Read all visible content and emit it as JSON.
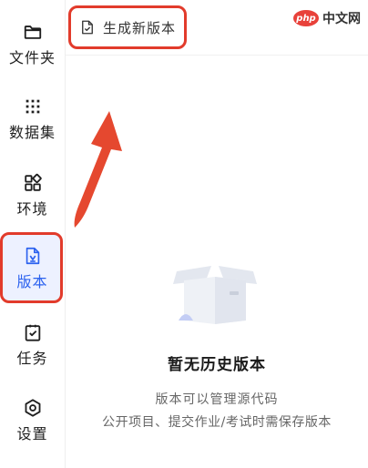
{
  "sidebar": {
    "items": [
      {
        "label": "文件夹",
        "icon": "folder-icon"
      },
      {
        "label": "数据集",
        "icon": "dataset-dots-icon"
      },
      {
        "label": "环境",
        "icon": "environment-grid-icon"
      },
      {
        "label": "版本",
        "icon": "version-document-icon",
        "active": true
      },
      {
        "label": "任务",
        "icon": "task-clipboard-icon"
      },
      {
        "label": "设置",
        "icon": "settings-gear-icon"
      }
    ]
  },
  "header": {
    "generate_version_label": "生成新版本"
  },
  "watermark": {
    "logo_text": "php",
    "site_text": "中文网"
  },
  "empty_state": {
    "title": "暂无历史版本",
    "line1": "版本可以管理源代码",
    "line2": "公开项目、提交作业/考试时需保存版本"
  },
  "colors": {
    "accent_blue": "#2c62ef",
    "highlight_red": "#e23b2b",
    "active_bg": "#edf1ff"
  }
}
